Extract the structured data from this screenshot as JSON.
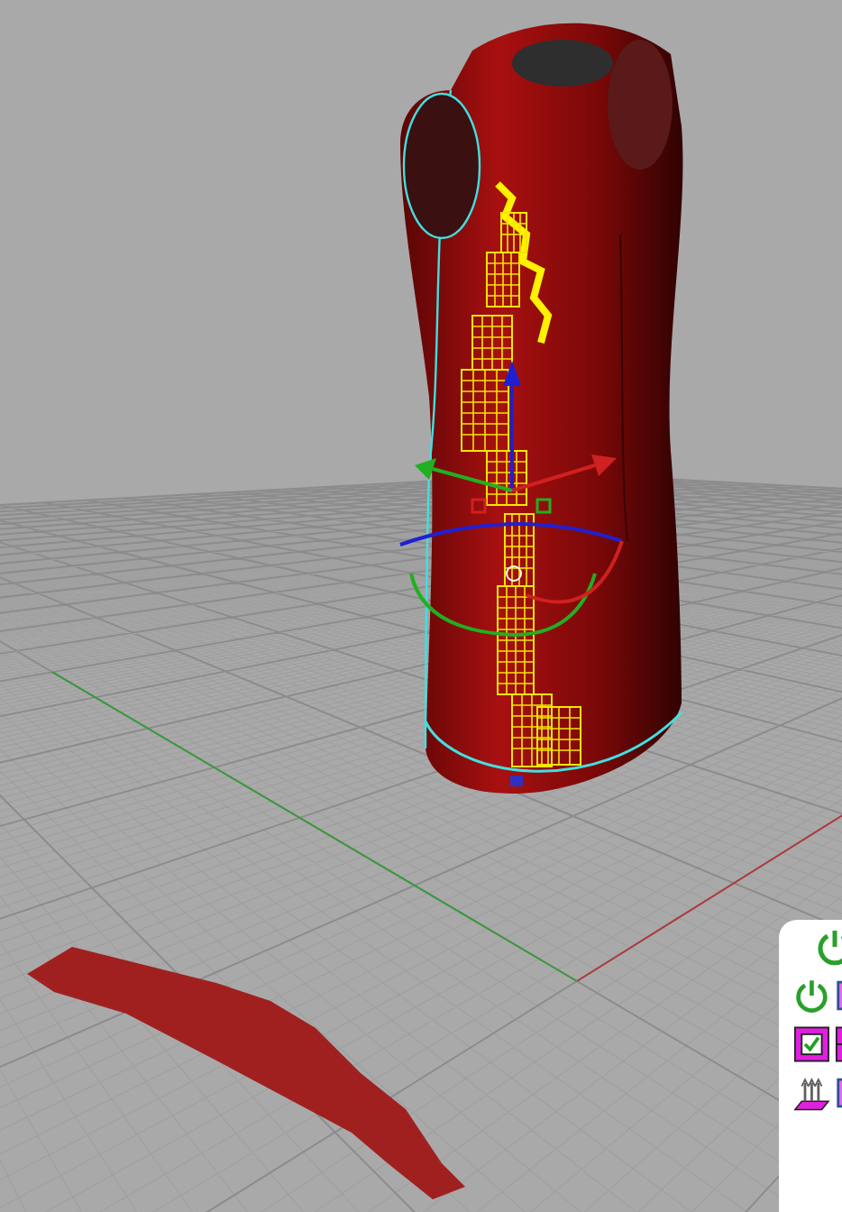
{
  "viewport": {
    "grid": true,
    "axes": true
  },
  "toolbar": {
    "rows": [
      {
        "buttons": [
          {
            "kind": "power"
          }
        ]
      },
      {
        "buttons": [
          {
            "kind": "power"
          },
          {
            "kind": "panel"
          }
        ]
      },
      {
        "buttons": [
          {
            "kind": "grid-check"
          },
          {
            "kind": "grid"
          }
        ]
      },
      {
        "buttons": [
          {
            "kind": "arrows"
          },
          {
            "kind": "panel"
          }
        ]
      }
    ]
  }
}
